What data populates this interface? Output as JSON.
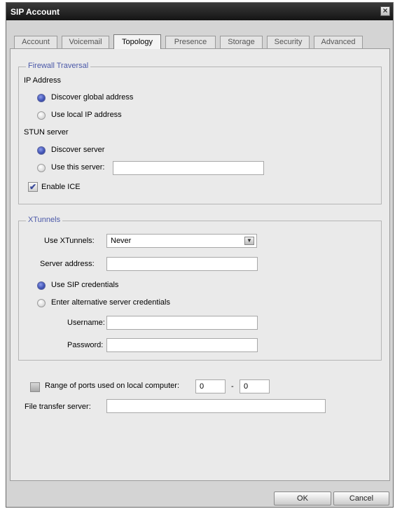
{
  "window": {
    "title": "SIP Account"
  },
  "tabs": [
    {
      "label": "Account",
      "active": false
    },
    {
      "label": "Voicemail",
      "active": false
    },
    {
      "label": "Topology",
      "active": true
    },
    {
      "label": "Presence",
      "active": false
    },
    {
      "label": "Storage",
      "active": false
    },
    {
      "label": "Security",
      "active": false
    },
    {
      "label": "Advanced",
      "active": false
    }
  ],
  "firewall": {
    "legend": "Firewall Traversal",
    "ip_address_label": "IP Address",
    "discover_global": {
      "label": "Discover global address",
      "selected": true
    },
    "use_local": {
      "label": "Use local IP address",
      "selected": false
    },
    "stun_label": "STUN server",
    "discover_server": {
      "label": "Discover server",
      "selected": true
    },
    "use_this_server": {
      "label": "Use this server:",
      "selected": false,
      "value": ""
    },
    "enable_ice": {
      "label": "Enable ICE",
      "checked": true
    }
  },
  "xtunnels": {
    "legend": "XTunnels",
    "use_label": "Use XTunnels:",
    "use_value": "Never",
    "server_address_label": "Server address:",
    "server_address_value": "",
    "use_sip_credentials": {
      "label": "Use SIP credentials",
      "selected": true
    },
    "alt_credentials": {
      "label": "Enter alternative server credentials",
      "selected": false
    },
    "username_label": "Username:",
    "username_value": "",
    "password_label": "Password:",
    "password_value": ""
  },
  "ports": {
    "label": "Range of ports used on local computer:",
    "checked": false,
    "from": "0",
    "separator": "-",
    "to": "0"
  },
  "file_transfer": {
    "label": "File transfer server:",
    "value": ""
  },
  "buttons": {
    "ok": "OK",
    "cancel": "Cancel"
  },
  "colors": {
    "legend": "#4a58a8",
    "radio_selected": "#4457b8",
    "titlebar": "#1e1e1e"
  }
}
